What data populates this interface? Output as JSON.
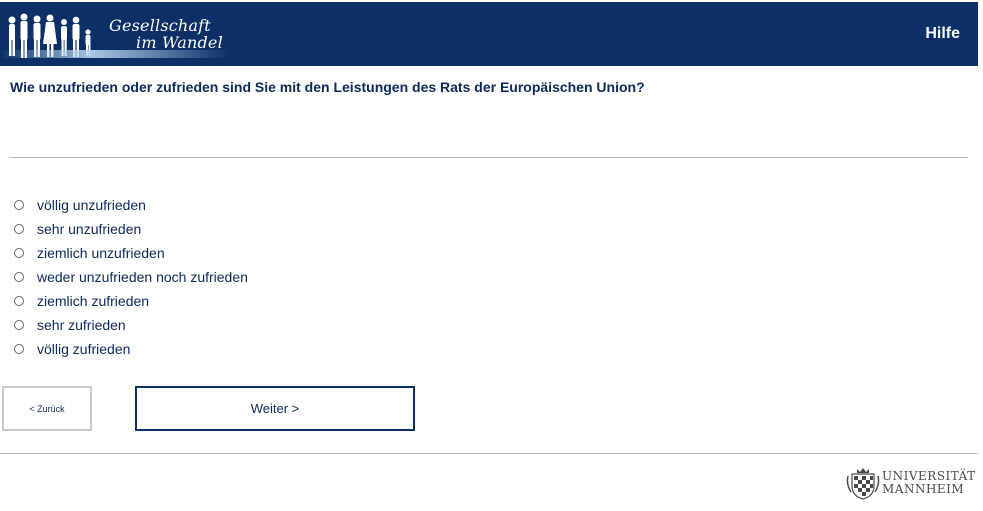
{
  "header": {
    "brand_line1": "Gesellschaft",
    "brand_line2": "im Wandel",
    "help_label": "Hilfe",
    "background_color": "#0b2f66"
  },
  "question": {
    "text": "Wie unzufrieden oder zufrieden sind Sie mit den Leistungen des Rats der Europäischen Union?"
  },
  "options": [
    {
      "label": "völlig unzufrieden"
    },
    {
      "label": "sehr unzufrieden"
    },
    {
      "label": "ziemlich unzufrieden"
    },
    {
      "label": "weder unzufrieden noch zufrieden"
    },
    {
      "label": "ziemlich zufrieden"
    },
    {
      "label": "sehr zufrieden"
    },
    {
      "label": "völlig zufrieden"
    }
  ],
  "navigation": {
    "back_label": "< Zurück",
    "next_label": "Weiter >"
  },
  "footer": {
    "university_line1": "UNIVERSITÄT",
    "university_line2": "MANNHEIM"
  }
}
